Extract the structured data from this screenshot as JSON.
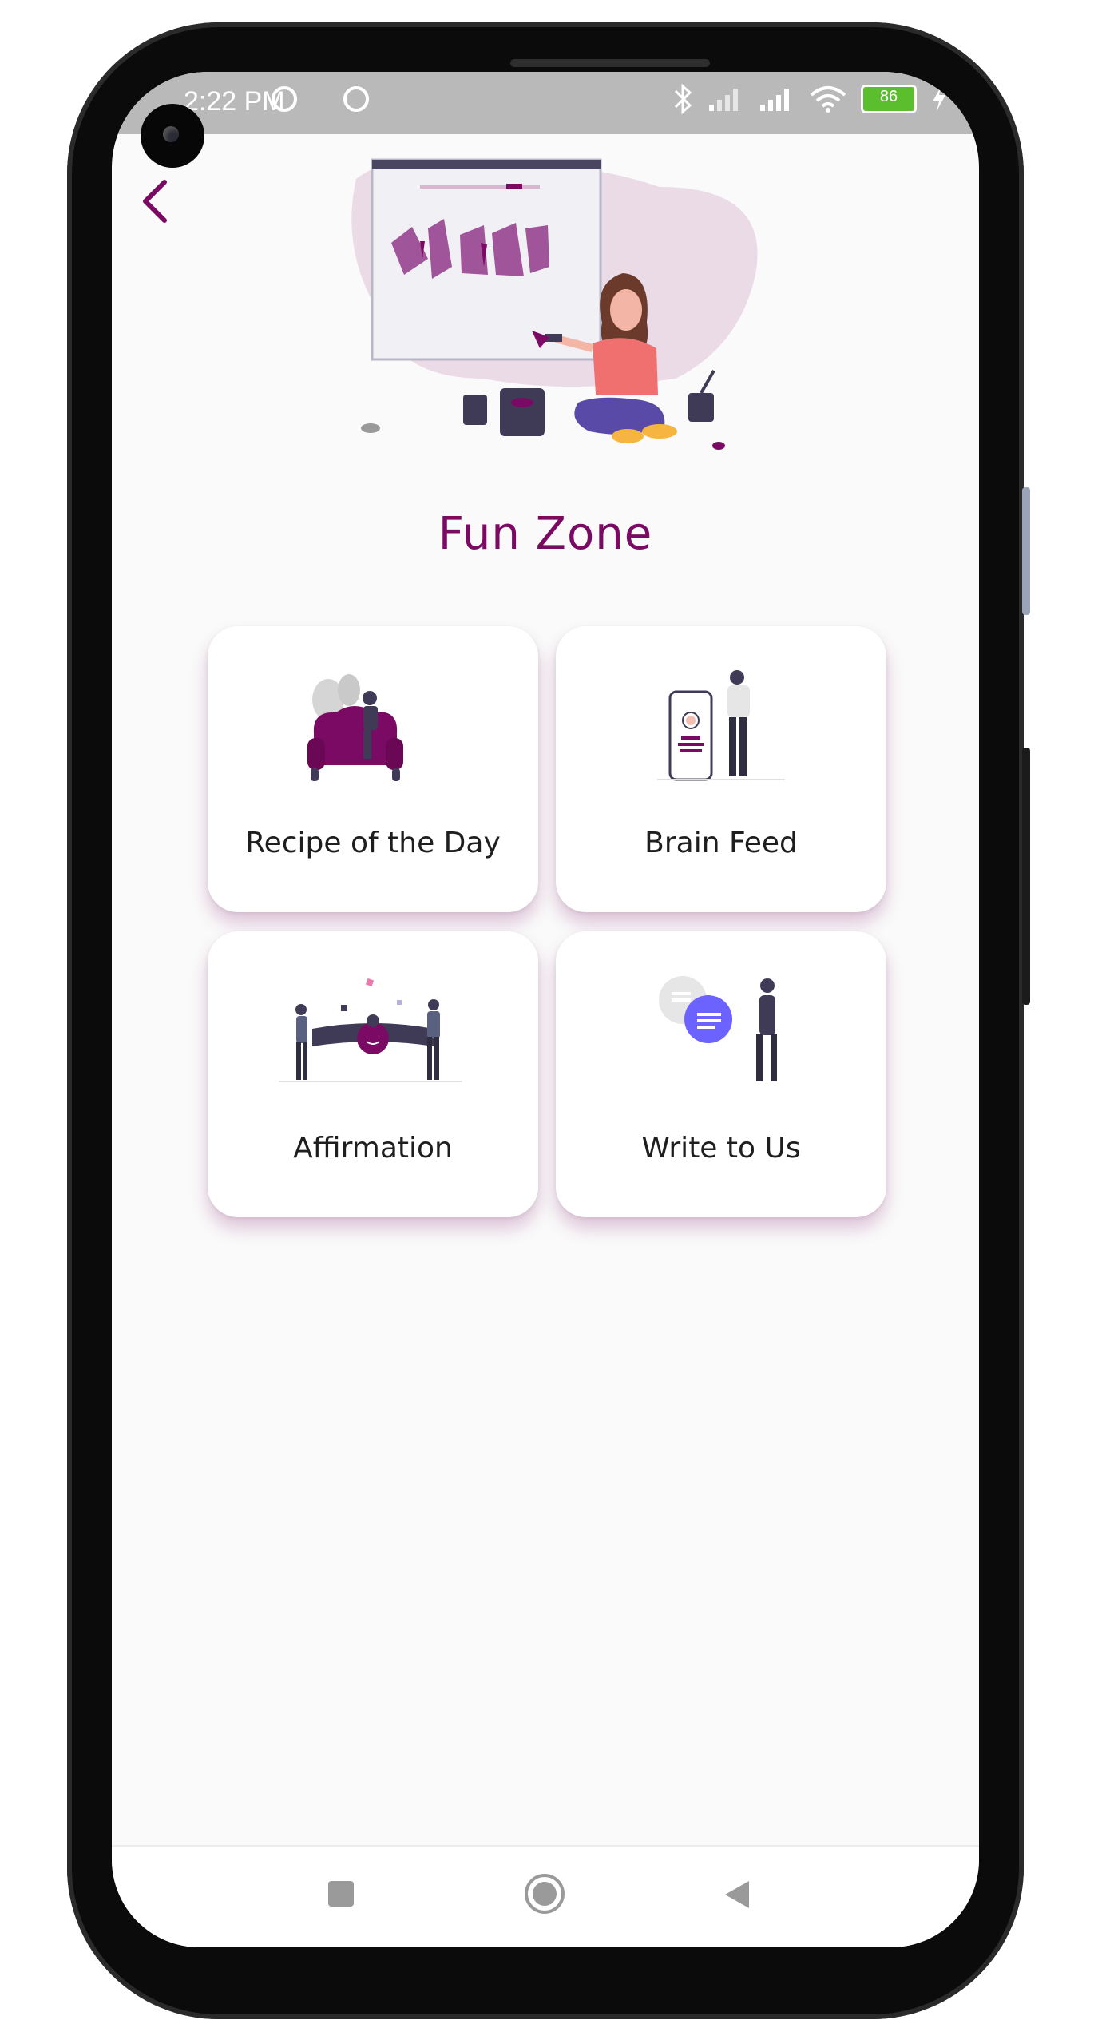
{
  "status_bar": {
    "time": "2:22 PM",
    "battery": "86"
  },
  "page": {
    "title": "Fun Zone"
  },
  "cards": [
    {
      "label": "Recipe of the Day"
    },
    {
      "label": "Brain Feed"
    },
    {
      "label": "Affirmation"
    },
    {
      "label": "Write to Us"
    }
  ],
  "colors": {
    "accent": "#7b0a64",
    "status_bar": "#b9b9b9",
    "background": "#fafafa"
  },
  "icons": {
    "back": "chevron-left-icon",
    "nav": [
      "square-recents-icon",
      "circle-home-icon",
      "triangle-back-icon"
    ]
  }
}
